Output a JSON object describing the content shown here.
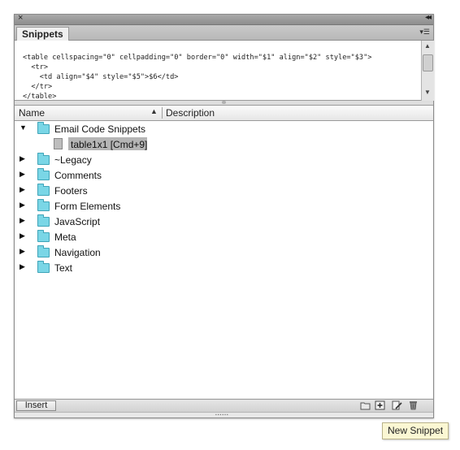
{
  "panel": {
    "close_glyph": "×",
    "collapse_glyph": "◂◂",
    "tab_label": "Snippets",
    "tab_menu_glyph": "▾☰"
  },
  "code_preview": {
    "lines": [
      "<table cellspacing=\"0\" cellpadding=\"0\" border=\"0\" width=\"$1\" align=\"$2\" style=\"$3\">",
      "  <tr>",
      "    <td align=\"$4\" style=\"$5\">$6</td>",
      "  </tr>",
      "</table>"
    ]
  },
  "columns": {
    "name": "Name",
    "description": "Description",
    "sort_indicator": "▲"
  },
  "tree": [
    {
      "label": "Email Code Snippets",
      "expanded": true,
      "type": "folder"
    },
    {
      "label": "table1x1 [Cmd+9]",
      "type": "snippet",
      "selected": true
    },
    {
      "label": "~Legacy",
      "expanded": false,
      "type": "folder"
    },
    {
      "label": "Comments",
      "expanded": false,
      "type": "folder"
    },
    {
      "label": "Footers",
      "expanded": false,
      "type": "folder"
    },
    {
      "label": "Form Elements",
      "expanded": false,
      "type": "folder"
    },
    {
      "label": "JavaScript",
      "expanded": false,
      "type": "folder"
    },
    {
      "label": "Meta",
      "expanded": false,
      "type": "folder"
    },
    {
      "label": "Navigation",
      "expanded": false,
      "type": "folder"
    },
    {
      "label": "Text",
      "expanded": false,
      "type": "folder"
    }
  ],
  "footer": {
    "insert_label": "Insert",
    "icons": [
      "new-folder-icon",
      "new-snippet-icon",
      "edit-snippet-icon",
      "delete-icon"
    ]
  },
  "tooltip": "New Snippet",
  "colors": {
    "folder": "#7ad6e6",
    "selection": "#b5b5b5",
    "tooltip_bg": "#fbf7d3"
  }
}
